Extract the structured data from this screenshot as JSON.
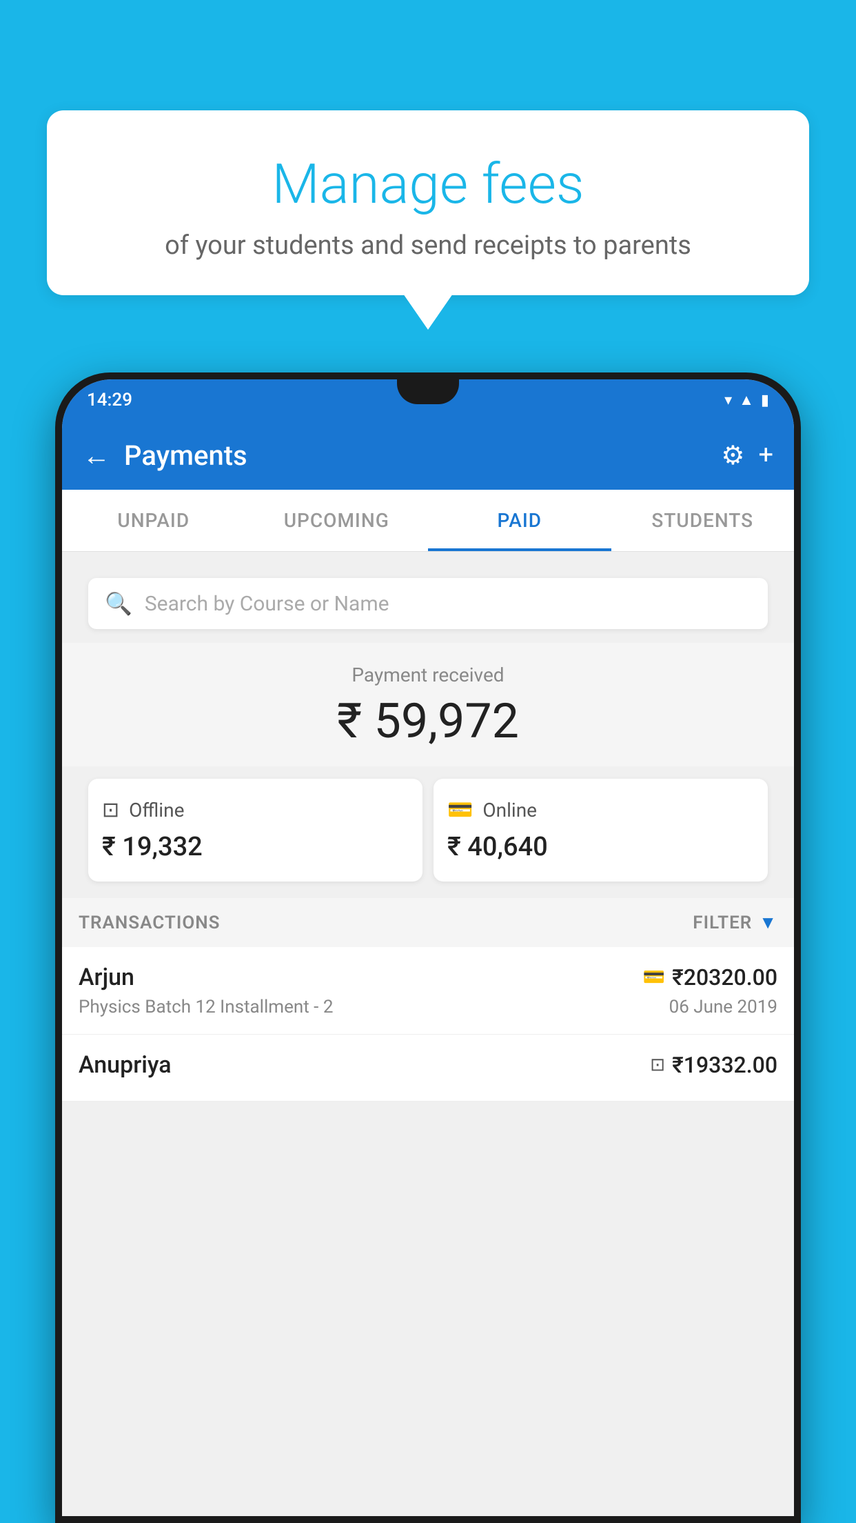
{
  "background_color": "#1ab6e8",
  "bubble": {
    "title": "Manage fees",
    "subtitle": "of your students and send receipts to parents"
  },
  "status_bar": {
    "time": "14:29",
    "icons": [
      "wifi",
      "signal",
      "battery"
    ]
  },
  "app_bar": {
    "title": "Payments",
    "back_label": "←",
    "settings_label": "⚙",
    "add_label": "+"
  },
  "tabs": [
    {
      "label": "UNPAID",
      "active": false
    },
    {
      "label": "UPCOMING",
      "active": false
    },
    {
      "label": "PAID",
      "active": true
    },
    {
      "label": "STUDENTS",
      "active": false
    }
  ],
  "search": {
    "placeholder": "Search by Course or Name"
  },
  "payment_summary": {
    "label": "Payment received",
    "amount": "₹ 59,972"
  },
  "payment_cards": [
    {
      "type": "Offline",
      "amount": "₹ 19,332",
      "icon": "₹"
    },
    {
      "type": "Online",
      "amount": "₹ 40,640",
      "icon": "💳"
    }
  ],
  "transactions_section": {
    "label": "TRANSACTIONS",
    "filter_label": "FILTER"
  },
  "transactions": [
    {
      "name": "Arjun",
      "course": "Physics Batch 12 Installment - 2",
      "amount": "₹20320.00",
      "date": "06 June 2019",
      "type_icon": "💳"
    },
    {
      "name": "Anupriya",
      "course": "",
      "amount": "₹19332.00",
      "date": "",
      "type_icon": "₹"
    }
  ]
}
